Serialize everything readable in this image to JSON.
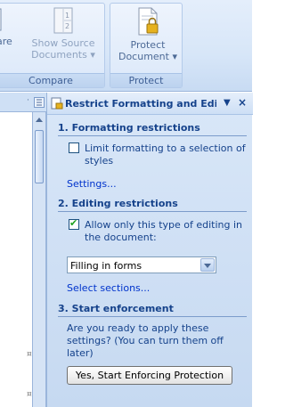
{
  "ribbon": {
    "compare_group_label": "Compare",
    "protect_group_label": "Protect",
    "compare_button": {
      "line1": "pare",
      "line2": ""
    },
    "show_source_button": {
      "line1": "Show Source",
      "line2": "Documents ▾"
    },
    "protect_button": {
      "line1": "Protect",
      "line2": "Document ▾"
    }
  },
  "pane": {
    "title": "Restrict Formatting and Editi",
    "menu_glyph": "▼",
    "close_glyph": "×",
    "formatting": {
      "heading": "1. Formatting restrictions",
      "checkbox_label_1": "Limit formatting to a selection of",
      "checkbox_label_2": "styles",
      "checked": false,
      "settings_link": "Settings..."
    },
    "editing": {
      "heading": "2. Editing restrictions",
      "checkbox_label_1": "Allow only this type of editing in",
      "checkbox_label_2": "the document:",
      "checked": true,
      "dropdown_value": "Filling in forms",
      "select_sections_link": "Select sections..."
    },
    "enforcement": {
      "heading": "3. Start enforcement",
      "prompt_1": "Are you ready to apply these",
      "prompt_2": "settings? (You can turn them off",
      "prompt_3": "later)",
      "button_label": "Yes, Start Enforcing Protection"
    }
  }
}
